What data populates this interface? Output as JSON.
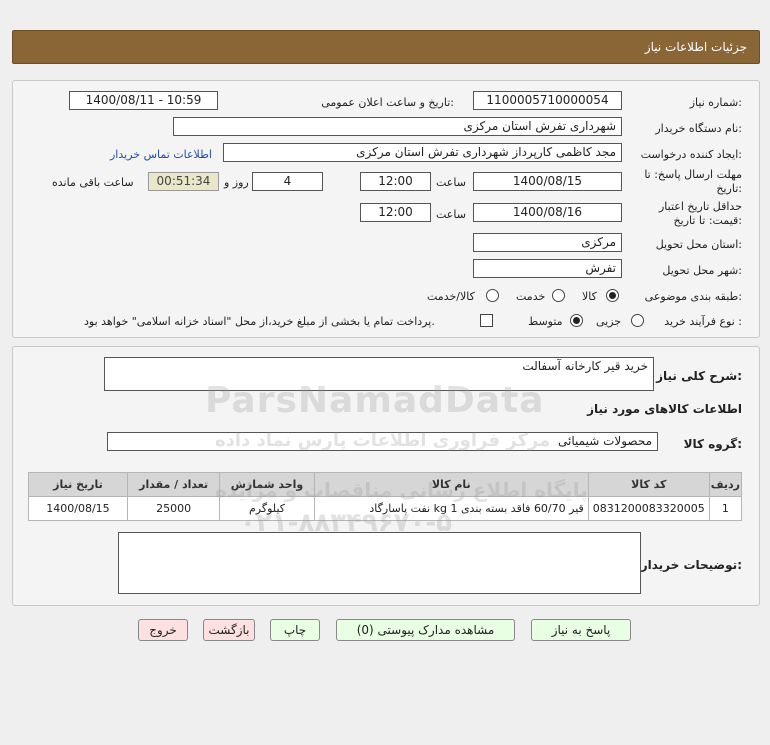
{
  "header": {
    "title": "جزئیات اطلاعات نیاز"
  },
  "form": {
    "need_number": {
      "label": "شماره نیاز:",
      "value": "1100005710000054"
    },
    "announce": {
      "label": "تاریخ و ساعت اعلان عمومی:",
      "value": "1400/08/11 - 10:59"
    },
    "buyer_org": {
      "label": "نام دستگاه خریدار:",
      "value": "شهرداری تفرش استان مرکزی"
    },
    "requester": {
      "label": "ایجاد کننده درخواست:",
      "value": "مجد کاظمی کارپرداز شهرداری تفرش استان مرکزی",
      "contact_link": "اطلاعات تماس خریدار"
    },
    "reply_deadline": {
      "label_line1": "مهلت ارسال پاسخ: تا",
      "label_line2": "تاریخ:",
      "date": "1400/08/15",
      "time_label": "ساعت",
      "time": "12:00",
      "days": "4",
      "days_label": "روز و",
      "remaining": "00:51:34",
      "remaining_label": "ساعت باقی مانده"
    },
    "price_validity": {
      "label_line1": "حداقل تاریخ اعتبار",
      "label_line2": "قیمت: تا تاریخ:",
      "date": "1400/08/16",
      "time_label": "ساعت",
      "time": "12:00"
    },
    "delivery_province": {
      "label": "استان محل تحویل:",
      "value": "مرکزی"
    },
    "delivery_city": {
      "label": "شهر محل تحویل:",
      "value": "تفرش"
    },
    "category": {
      "label": "طبقه بندی موضوعی:",
      "options": [
        "کالا",
        "خدمت",
        "کالا/خدمت"
      ],
      "selected": "کالا"
    },
    "process_type": {
      "label": "نوع فرآیند خرید :",
      "options": [
        "جزیی",
        "متوسط"
      ],
      "selected": "متوسط",
      "payment_note": "پرداخت تمام یا بخشی از مبلغ خرید،از محل \"اسناد خزانه اسلامی\" خواهد بود."
    }
  },
  "details": {
    "summary_label": "شرح کلی نیاز:",
    "summary_value": "خرید قیر کارخانه آسفالت",
    "goods_info_title": "اطلاعات کالاهای مورد نیاز",
    "goods_group_label": "گروه کالا:",
    "goods_group_value": "محصولات شیمیائی",
    "table": {
      "headers": [
        "ردیف",
        "کد کالا",
        "نام کالا",
        "واحد شمارش",
        "تعداد / مقدار",
        "تاریخ نیاز"
      ],
      "rows": [
        [
          "1",
          "0831200083320005",
          "قیر 60/70 فاقد بسته بندی 1 kg نفت پاسارگاد",
          "کیلوگرم",
          "25000",
          "1400/08/15"
        ]
      ]
    },
    "buyer_notes_label": "توضیحات خریدار:",
    "buyer_notes_value": ""
  },
  "buttons": {
    "reply": "پاسخ به نیاز",
    "attachments": "مشاهده مدارک پیوستی (0)",
    "print": "چاپ",
    "back": "بازگشت",
    "exit": "خروج"
  },
  "watermark": {
    "brand": "ParsNamadData",
    "line1": "مرکز فراوری اطلاعات پارس نماد داده",
    "line2": "پایگاه اطلاع رسانی مناقصات و مزایده",
    "phone": "۰۲۱-۸۸۳۴۹۶۷۰-۵"
  }
}
